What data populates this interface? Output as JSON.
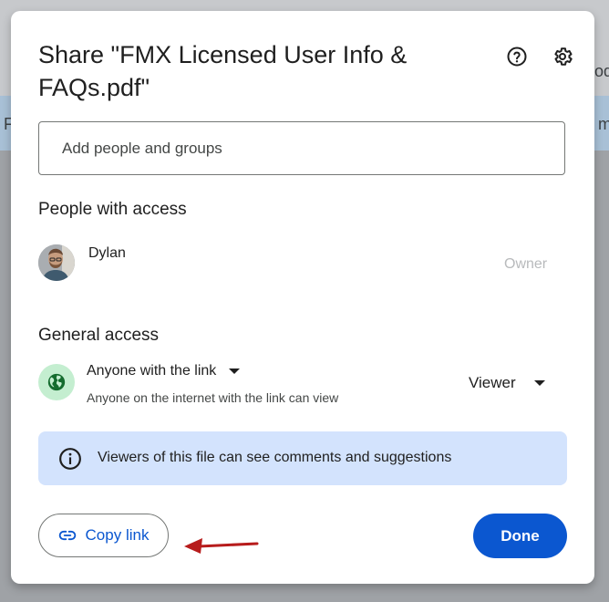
{
  "background": {
    "right_text_top": "od",
    "left_text_band": "F",
    "right_text_band": "m"
  },
  "dialog": {
    "title": "Share \"FMX Licensed User Info & FAQs.pdf\"",
    "help_icon": "help-circle-icon",
    "settings_icon": "gear-icon",
    "add_people_placeholder": "Add people and groups",
    "people_section_title": "People with access",
    "people": [
      {
        "name": "Dylan",
        "role": "Owner"
      }
    ],
    "general_access_title": "General access",
    "general_access": {
      "option": "Anyone with the link",
      "description": "Anyone on the internet with the link can view",
      "role": "Viewer",
      "icon": "globe-icon"
    },
    "info_message": "Viewers of this file can see comments and suggestions",
    "copy_link_label": "Copy link",
    "done_label": "Done"
  },
  "colors": {
    "primary": "#0b57d0",
    "info_bg": "#d3e3fd",
    "globe_bg": "#c4eed0",
    "annotation_arrow": "#b71c1c"
  }
}
